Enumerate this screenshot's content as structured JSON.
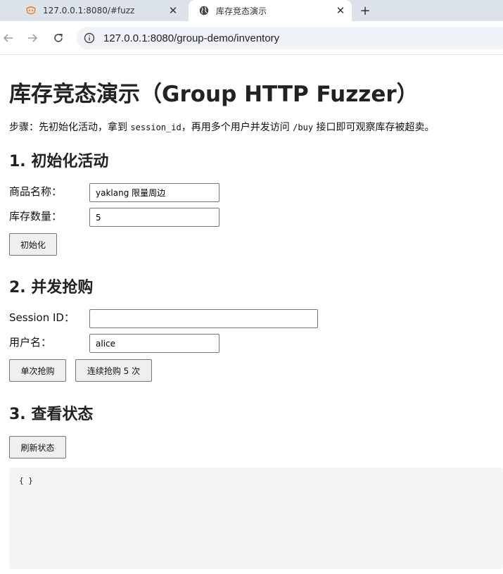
{
  "browser": {
    "tabs": [
      {
        "title": "127.0.0.1:8080/#fuzz",
        "favicon": "yak-icon",
        "active": false
      },
      {
        "title": "库存竞态演示",
        "favicon": "globe-icon",
        "active": true
      }
    ],
    "new_tab_label": "+",
    "close_label": "✕",
    "url": "127.0.0.1:8080/group-demo/inventory"
  },
  "page": {
    "title": "库存竞态演示（Group HTTP Fuzzer）",
    "steps": {
      "prefix": "步骤：先初始化活动，拿到 ",
      "code1": "session_id",
      "middle": "，再用多个用户并发访问 ",
      "code2": "/buy",
      "suffix": " 接口即可观察库存被超卖。"
    },
    "init": {
      "heading": "1. 初始化活动",
      "product_label": "商品名称：",
      "product_value": "yaklang 限量周边",
      "stock_label": "库存数量：",
      "stock_value": "5",
      "button": "初始化"
    },
    "buy": {
      "heading": "2. 并发抢购",
      "session_label": "Session ID：",
      "session_value": "",
      "user_label": "用户名：",
      "user_value": "alice",
      "single_button": "单次抢购",
      "multi_button": "连续抢购 5 次"
    },
    "status": {
      "heading": "3. 查看状态",
      "refresh_button": "刷新状态",
      "output": "{ }"
    }
  },
  "colors": {
    "tabstrip": "#dde3ea",
    "omnibox": "#eff2f6",
    "button_bg": "#efefef",
    "output_bg": "#f5f5f5"
  }
}
